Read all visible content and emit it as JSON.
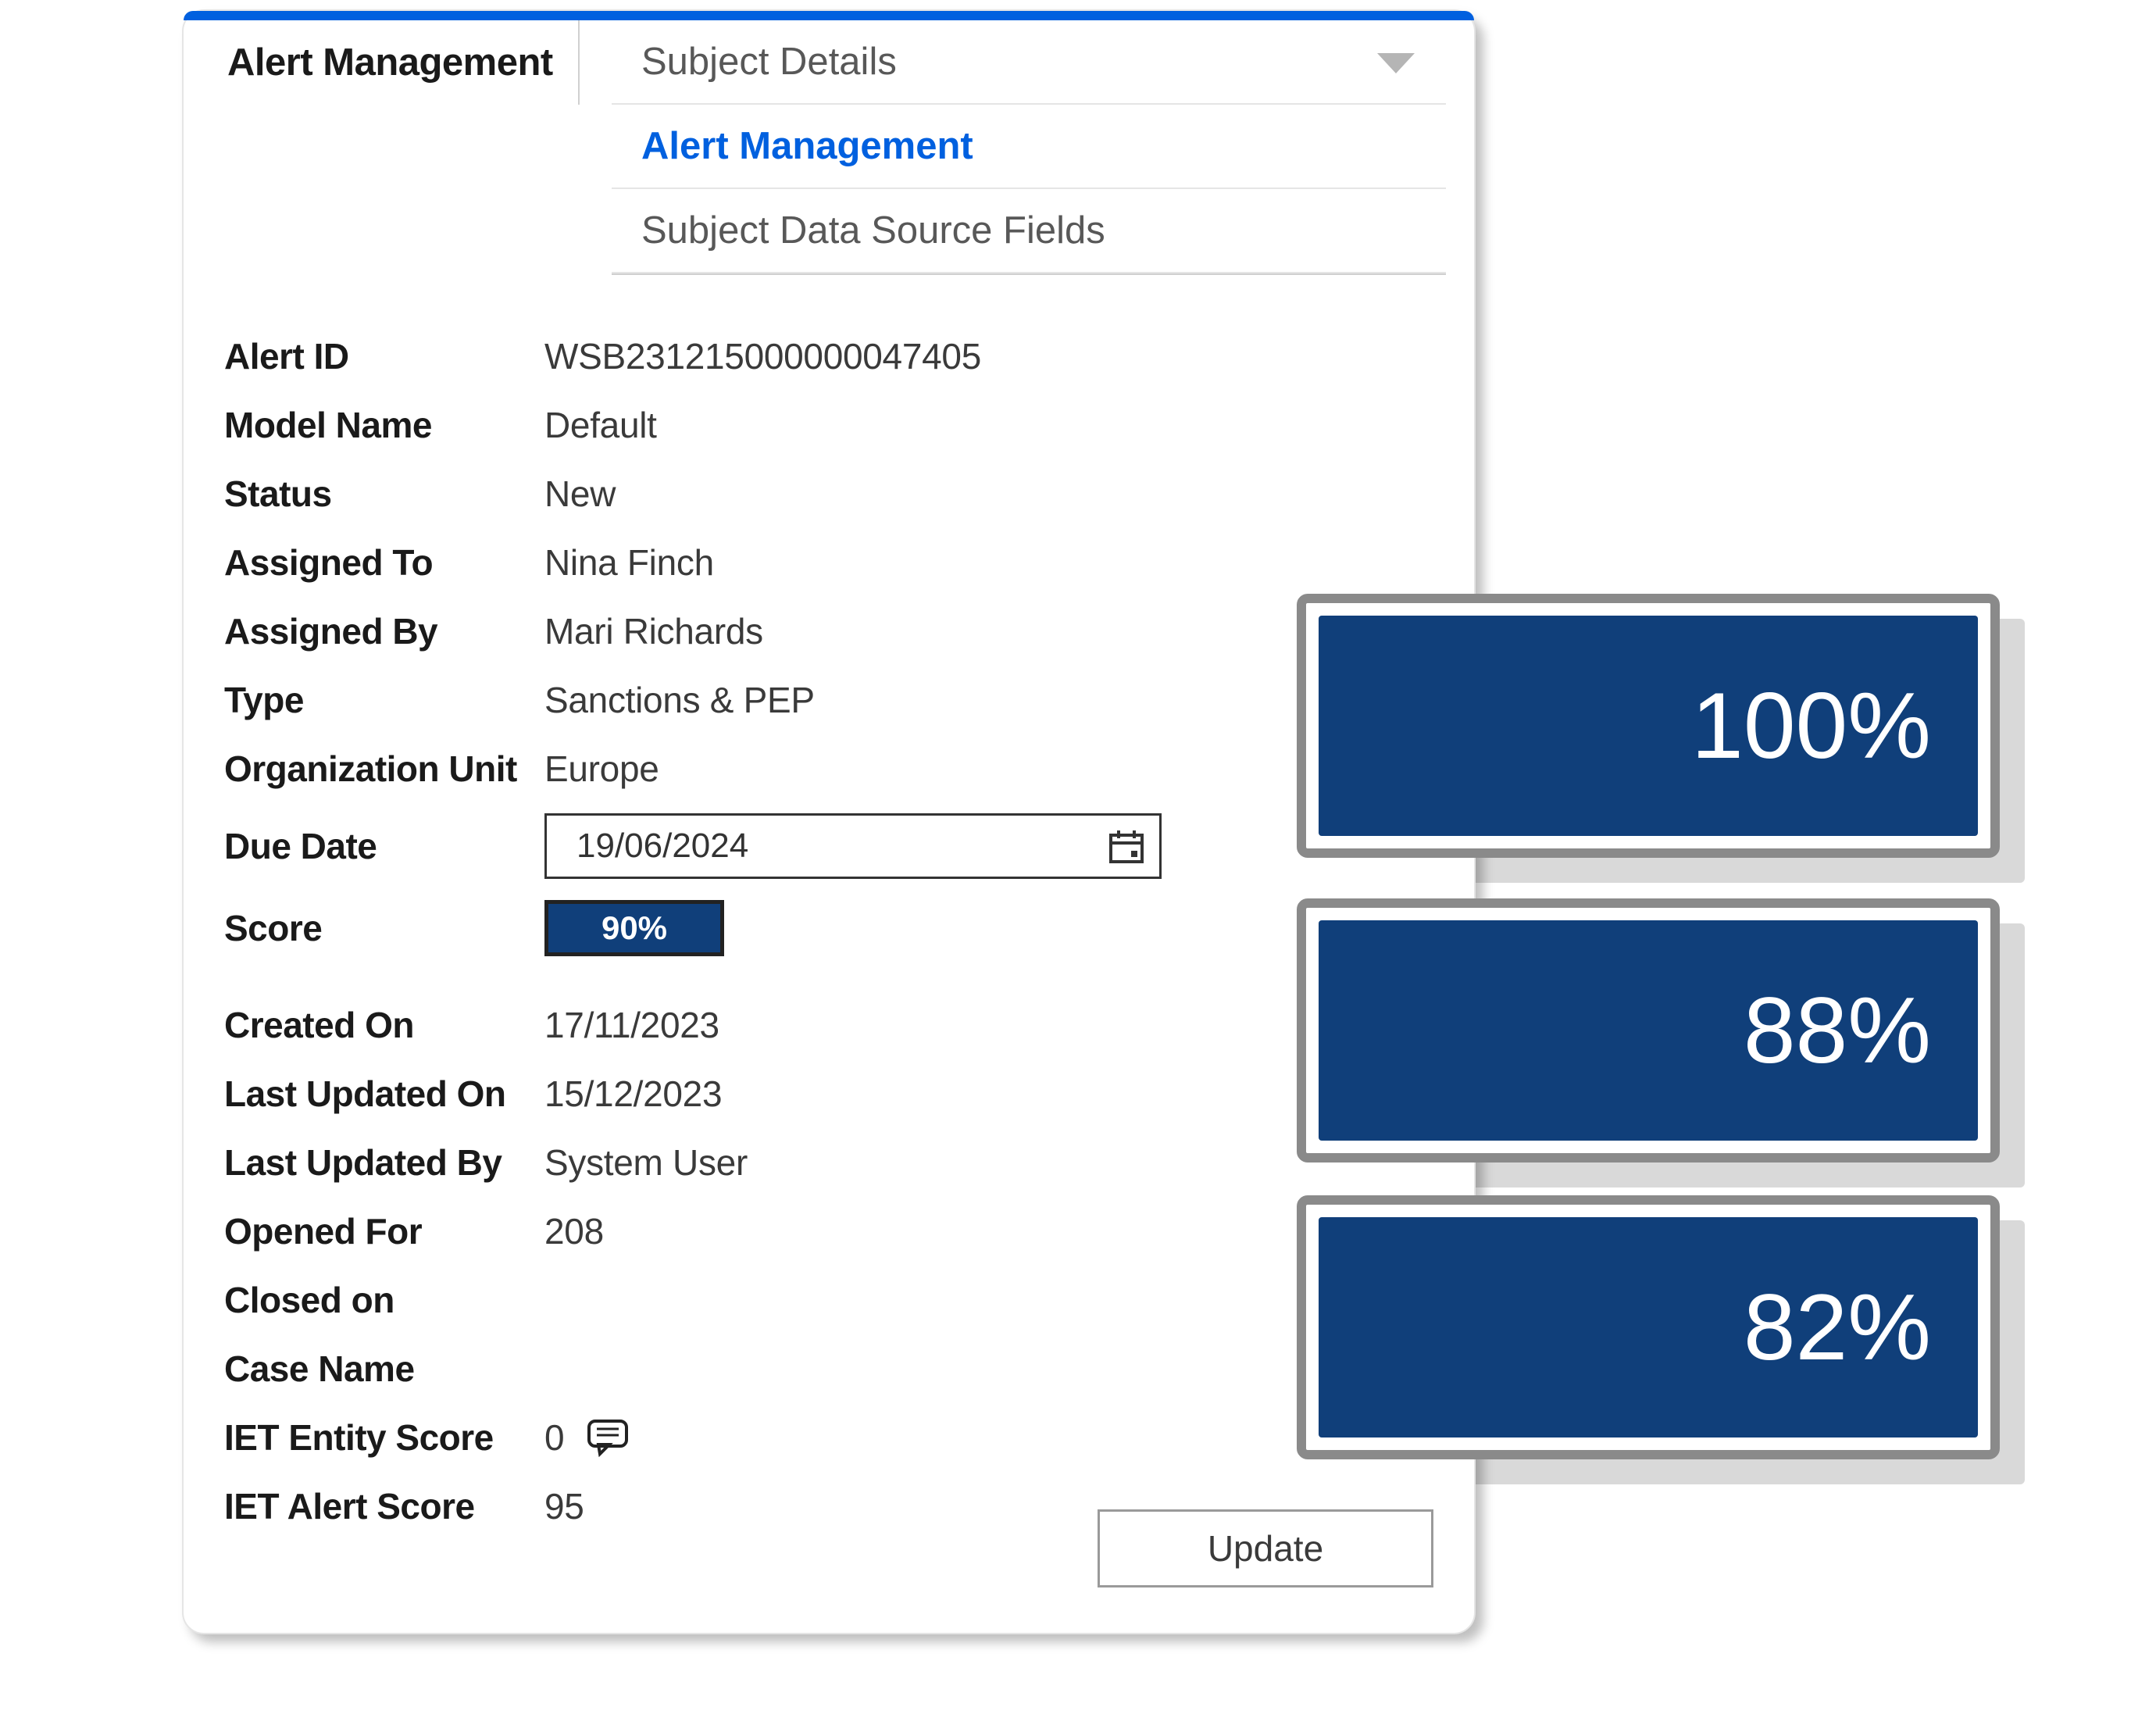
{
  "tab": {
    "active_label": "Alert Management"
  },
  "dropdown": {
    "items": [
      {
        "label": "Subject Details",
        "selected": false
      },
      {
        "label": "Alert Management",
        "selected": true
      },
      {
        "label": "Subject Data Source Fields",
        "selected": false
      }
    ]
  },
  "labels": {
    "alert_id": "Alert ID",
    "model_name": "Model Name",
    "status": "Status",
    "assigned_to": "Assigned To",
    "assigned_by": "Assigned By",
    "type": "Type",
    "org_unit": "Organization Unit",
    "due_date": "Due Date",
    "score": "Score",
    "created_on": "Created On",
    "last_updated_on": "Last Updated On",
    "last_updated_by": "Last Updated By",
    "opened_for": "Opened For",
    "closed_on": "Closed on",
    "case_name": "Case Name",
    "iet_entity_score": "IET Entity Score",
    "iet_alert_score": "IET Alert Score"
  },
  "values": {
    "alert_id": "WSB231215000000047405",
    "model_name": "Default",
    "status": "New",
    "assigned_to": "Nina Finch",
    "assigned_by": "Mari Richards",
    "type": "Sanctions & PEP",
    "org_unit": "Europe",
    "due_date": "19/06/2024",
    "score": "90%",
    "created_on": "17/11/2023",
    "last_updated_on": "15/12/2023",
    "last_updated_by": "System User",
    "opened_for": "208",
    "closed_on": "",
    "case_name": "",
    "iet_entity_score": "0",
    "iet_alert_score": "95"
  },
  "buttons": {
    "update": "Update"
  },
  "tiles": {
    "t1": "100%",
    "t2": "88%",
    "t3": "82%"
  }
}
